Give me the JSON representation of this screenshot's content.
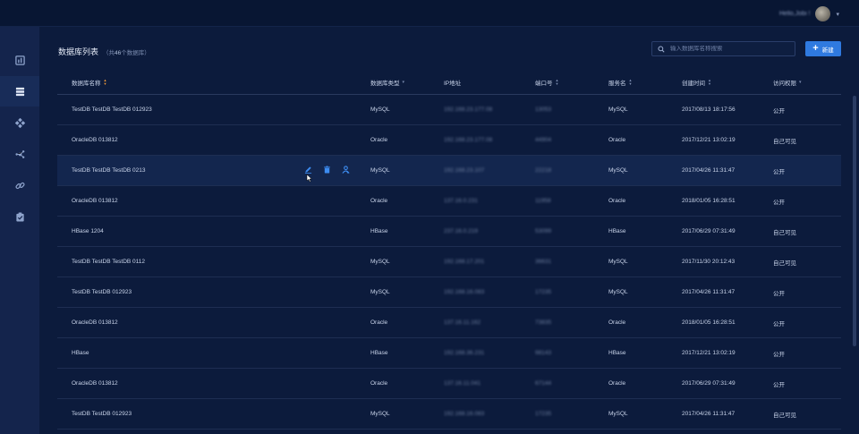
{
  "header": {
    "user_name": "Hello,Jobi !",
    "avatar_icon": "user-avatar",
    "dropdown_icon": "chevron-down-icon"
  },
  "sidebar": {
    "items": [
      {
        "icon": "dashboard-icon",
        "active": false
      },
      {
        "icon": "database-icon",
        "active": true
      },
      {
        "icon": "modules-icon",
        "active": false
      },
      {
        "icon": "share-icon",
        "active": false
      },
      {
        "icon": "link-icon",
        "active": false
      },
      {
        "icon": "clipboard-check-icon",
        "active": false
      }
    ]
  },
  "page": {
    "title": "数据库列表",
    "count_prefix": "（共",
    "count": "46",
    "count_suffix": "个数据库）",
    "search_placeholder": "输入数据库名称搜索",
    "new_button": "新建"
  },
  "table": {
    "columns": {
      "name": "数据库名称",
      "type": "数据库类型",
      "ip": "IP地址",
      "port": "端口号",
      "service": "服务名",
      "created": "创建时间",
      "access": "访问权限"
    },
    "rows": [
      {
        "name": "TestDB TestDB TestDB 012923",
        "type": "MySQL",
        "ip": "192.168.23.177.08",
        "port": "13053",
        "service": "MySQL",
        "created": "2017/08/13 18:17:56",
        "access": "公开"
      },
      {
        "name": "OracleDB 013812",
        "type": "Oracle",
        "ip": "192.168.23.177.08",
        "port": "44904",
        "service": "Oracle",
        "created": "2017/12/21 13:02:19",
        "access": "自己可见"
      },
      {
        "name": "TestDB TestDB TestDB 0213",
        "type": "MySQL",
        "ip": "192.168.23.107",
        "port": "22218",
        "service": "MySQL",
        "created": "2017/04/26 11:31:47",
        "access": "公开"
      },
      {
        "name": "OracleDB 013812",
        "type": "Oracle",
        "ip": "137.16.0.231",
        "port": "11958",
        "service": "Oracle",
        "created": "2018/01/05 16:28:51",
        "access": "公开"
      },
      {
        "name": "HBase 1204",
        "type": "HBase",
        "ip": "237.16.0.219",
        "port": "53099",
        "service": "HBase",
        "created": "2017/06/29 07:31:49",
        "access": "自己可见"
      },
      {
        "name": "TestDB TestDB TestDB 0112",
        "type": "MySQL",
        "ip": "192.168.17.201",
        "port": "36631",
        "service": "MySQL",
        "created": "2017/11/30 20:12:43",
        "access": "自己可见"
      },
      {
        "name": "TestDB TestDB 012923",
        "type": "MySQL",
        "ip": "192.168.16.083",
        "port": "17235",
        "service": "MySQL",
        "created": "2017/04/26 11:31:47",
        "access": "公开"
      },
      {
        "name": "OracleDB 013812",
        "type": "Oracle",
        "ip": "137.16.11.162",
        "port": "73835",
        "service": "Oracle",
        "created": "2018/01/05 16:28:51",
        "access": "公开"
      },
      {
        "name": "HBase",
        "type": "HBase",
        "ip": "192.168.36.231",
        "port": "98143",
        "service": "HBase",
        "created": "2017/12/21 13:02:19",
        "access": "公开"
      },
      {
        "name": "OracleDB 013812",
        "type": "Oracle",
        "ip": "137.16.11.041",
        "port": "67144",
        "service": "Oracle",
        "created": "2017/06/29 07:31:49",
        "access": "公开"
      },
      {
        "name": "TestDB TestDB 012923",
        "type": "MySQL",
        "ip": "192.168.16.083",
        "port": "17235",
        "service": "MySQL",
        "created": "2017/04/26 11:31:47",
        "access": "自己可见"
      }
    ],
    "row_actions": [
      "edit-icon",
      "delete-icon",
      "user-permission-icon"
    ]
  },
  "colors": {
    "accent": "#2f7ae0",
    "sort_active": "#f09a3a"
  }
}
